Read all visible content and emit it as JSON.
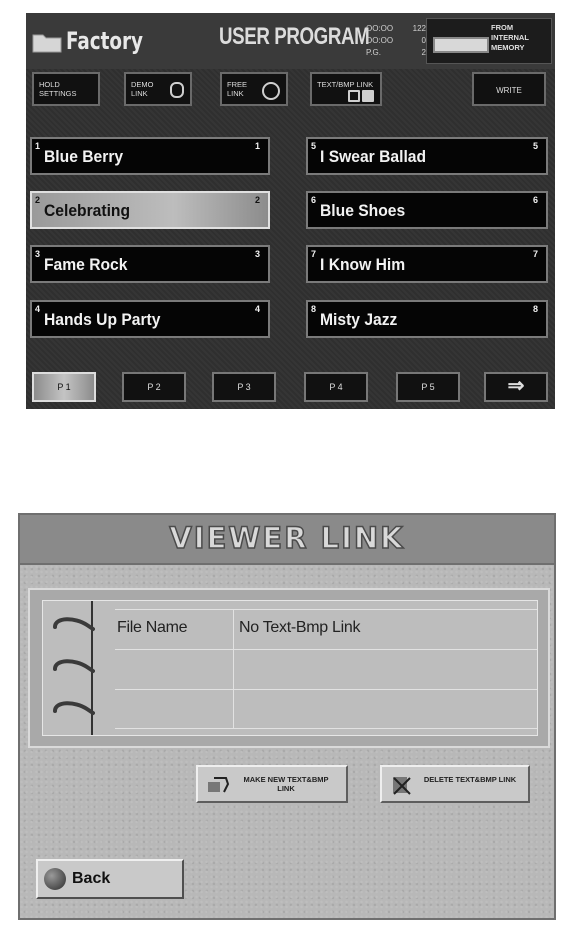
{
  "user_program": {
    "folder": "Factory",
    "title": "USER PROGRAM",
    "counters": [
      {
        "label": "OO:OO",
        "value": "122"
      },
      {
        "label": "OO:OO",
        "value": "0"
      },
      {
        "label": "P.G.",
        "value": "2"
      }
    ],
    "memory_label": "FROM INTERNAL MEMORY",
    "toolbar": [
      {
        "label": "HOLD SETTINGS",
        "icon": "none"
      },
      {
        "label": "DEMO LINK",
        "icon": "link-icon"
      },
      {
        "label": "FREE LINK",
        "icon": "disc-icon"
      },
      {
        "label": "TEXT/BMP LINK",
        "icon": "image-icon"
      },
      {
        "label": "WRITE",
        "icon": "none"
      }
    ],
    "songs": [
      {
        "num": "1",
        "name": "Blue Berry",
        "selected": false
      },
      {
        "num": "5",
        "name": "I Swear Ballad",
        "selected": false
      },
      {
        "num": "2",
        "name": "Celebrating",
        "selected": true
      },
      {
        "num": "6",
        "name": "Blue Shoes",
        "selected": false
      },
      {
        "num": "3",
        "name": "Fame Rock",
        "selected": false
      },
      {
        "num": "7",
        "name": "I Know Him",
        "selected": false
      },
      {
        "num": "4",
        "name": "Hands Up Party",
        "selected": false
      },
      {
        "num": "8",
        "name": "Misty Jazz",
        "selected": false
      }
    ],
    "pages": [
      "P 1",
      "P 2",
      "P 3",
      "P 4",
      "P 5"
    ],
    "next_label": "⇒"
  },
  "viewer_link": {
    "title": "VIEWER LINK",
    "columns": {
      "file_name": "File Name",
      "value": "No Text-Bmp Link"
    },
    "make_new_label": "MAKE NEW TEXT&BMP LINK",
    "delete_label": "DELETE TEXT&BMP LINK",
    "back_label": "Back"
  },
  "colors": {
    "screen_bg": "#333333",
    "window_bg": "#b8b8b8",
    "selected_fill": "#b5b5b5"
  }
}
